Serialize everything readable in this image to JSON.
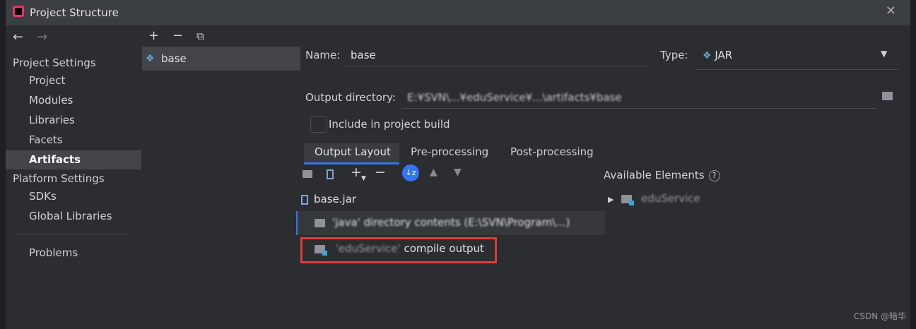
{
  "window": {
    "title": "Project Structure"
  },
  "sidebar": {
    "project_settings_header": "Project Settings",
    "items": [
      "Project",
      "Modules",
      "Libraries",
      "Facets",
      "Artifacts"
    ],
    "platform_settings_header": "Platform Settings",
    "platform_items": [
      "SDKs",
      "Global Libraries"
    ],
    "problems": "Problems",
    "active_item": "Artifacts"
  },
  "artifacts": {
    "items": [
      "base"
    ]
  },
  "form": {
    "name_label": "Name:",
    "name_value": "base",
    "type_label": "Type:",
    "type_value": "JAR",
    "output_dir_label": "Output directory:",
    "output_dir_value": "E:¥SVN\\...¥eduService¥...\\artifacts¥base",
    "include_build_label": "Include in project build",
    "include_build_checked": false
  },
  "tabs": [
    "Output Layout",
    "Pre-processing",
    "Post-processing"
  ],
  "active_tab": "Output Layout",
  "output_layout": {
    "root": "base.jar",
    "rows": [
      {
        "text": "'java' directory contents (E:\\SVN\\Program\\...)"
      },
      {
        "text_blurred": "'eduService'",
        "text_suffix": " compile output"
      }
    ]
  },
  "available_elements": {
    "header": "Available Elements",
    "items": [
      "eduService"
    ]
  },
  "watermark": "CSDN @暗华",
  "colors": {
    "accent": "#3574f0",
    "highlight_box": "#e5393b"
  },
  "icons": {
    "back": "arrow-left-icon",
    "forward": "arrow-right-icon",
    "add": "plus-icon",
    "remove": "minus-icon",
    "copy": "copy-icon"
  }
}
